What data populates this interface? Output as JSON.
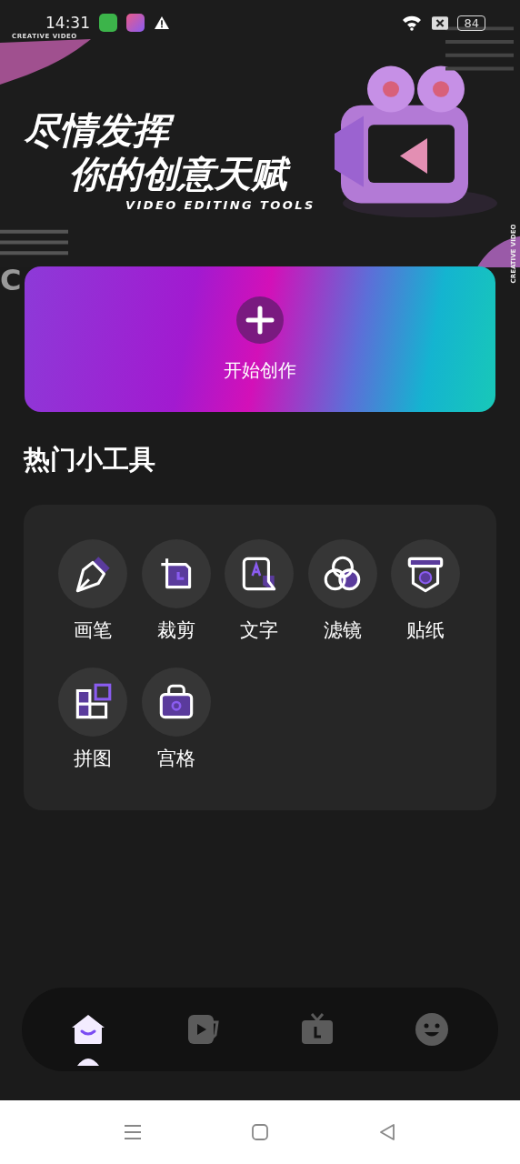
{
  "status_bar": {
    "time": "14:31",
    "battery": "84"
  },
  "banner": {
    "kind": "picture",
    "tag_top": "CREATIVE VIDEO",
    "headline_1": "尽情发挥",
    "headline_2": "你的创意天赋",
    "subtitle": "VIDEO EDITING TOOLS",
    "tag_side": "CREATIVE VIDEO",
    "corner_text": "C"
  },
  "create_card": {
    "label": "开始创作"
  },
  "section_title": "热门小工具",
  "tools": [
    {
      "kind": "pen",
      "label": "画笔"
    },
    {
      "kind": "crop",
      "label": "裁剪"
    },
    {
      "kind": "text",
      "label": "文字"
    },
    {
      "kind": "filter",
      "label": "滤镜"
    },
    {
      "kind": "sticker",
      "label": "贴纸"
    },
    {
      "kind": "collage",
      "label": "拼图"
    },
    {
      "kind": "grid",
      "label": "宫格"
    }
  ],
  "bottom_nav": [
    {
      "kind": "home",
      "selected": true
    },
    {
      "kind": "video",
      "selected": false
    },
    {
      "kind": "tv",
      "selected": false
    },
    {
      "kind": "face",
      "selected": false
    }
  ]
}
